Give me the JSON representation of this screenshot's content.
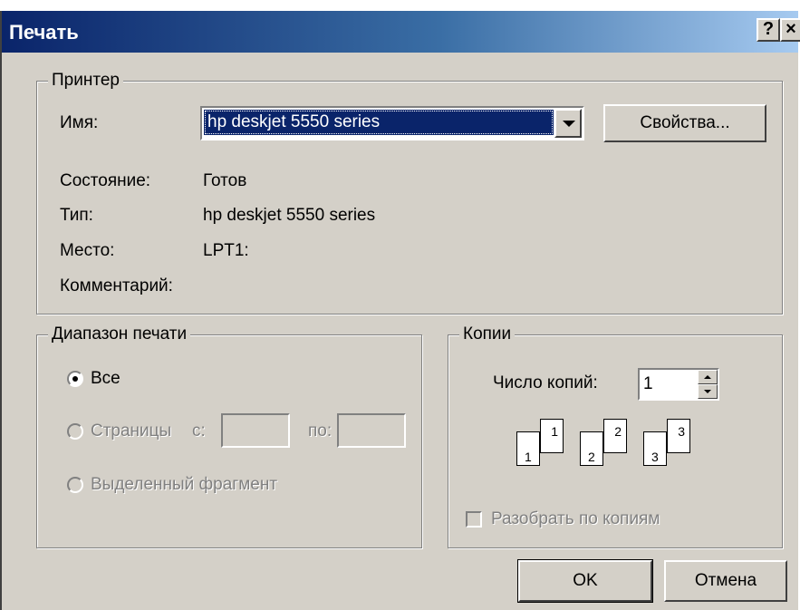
{
  "window": {
    "title": "Печать",
    "help_label": "?",
    "close_label": "×"
  },
  "printer": {
    "legend": "Принтер",
    "name_label": "Имя:",
    "selected_printer": "hp deskjet 5550 series",
    "properties_button": "Свойства...",
    "status_label": "Состояние:",
    "status_value": "Готов",
    "type_label": "Тип:",
    "type_value": "hp deskjet 5550 series",
    "location_label": "Место:",
    "location_value": "LPT1:",
    "comment_label": "Комментарий:",
    "comment_value": ""
  },
  "range": {
    "legend": "Диапазон печати",
    "all_label": "Все",
    "pages_label": "Страницы",
    "from_label": "с:",
    "to_label": "по:",
    "from_value": "",
    "to_value": "",
    "selection_label": "Выделенный фрагмент",
    "selected": "all"
  },
  "copies": {
    "legend": "Копии",
    "count_label": "Число копий:",
    "count_value": "1",
    "collate_label": "Разобрать по копиям",
    "collate_checked": false,
    "collate_enabled": false,
    "page_icons": [
      {
        "back": "1",
        "front": "1"
      },
      {
        "back": "2",
        "front": "2"
      },
      {
        "back": "3",
        "front": "3"
      }
    ]
  },
  "buttons": {
    "ok": "OK",
    "cancel": "Отмена"
  }
}
